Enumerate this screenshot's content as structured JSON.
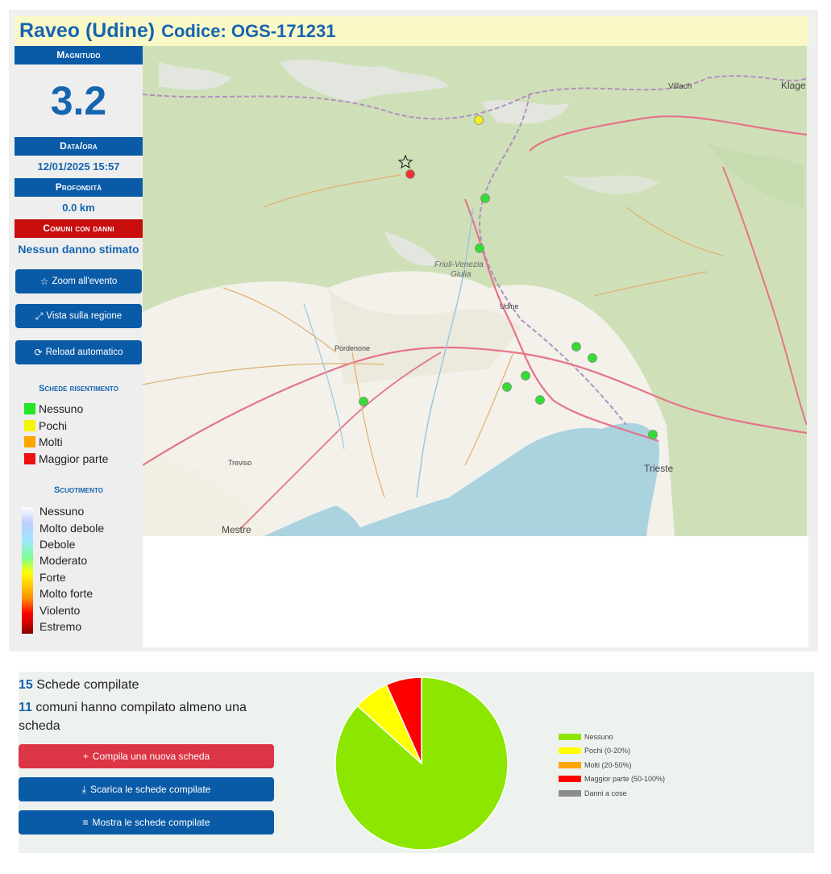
{
  "event": {
    "place": "Raveo (Udine)",
    "code_label": "Codice: OGS-171231"
  },
  "sidebar": {
    "magnitude_label": "Magnitudo",
    "magnitude_value": "3.2",
    "datetime_label": "Data/ora",
    "datetime_value": "12/01/2025 15:57",
    "depth_label": "Profondità",
    "depth_value": "0.0 km",
    "damage_label": "Comuni con danni",
    "damage_value": "Nessun danno stimato",
    "buttons": {
      "zoom": "Zoom all'evento",
      "region": "Vista sulla regione",
      "reload": "Reload automatico"
    },
    "felt_title": "Schede risentimento",
    "felt_items": [
      {
        "label": "Nessuno",
        "color": "#22e622"
      },
      {
        "label": "Pochi",
        "color": "#f5f500"
      },
      {
        "label": "Molti",
        "color": "#ffa500"
      },
      {
        "label": "Maggior parte",
        "color": "#ee1111"
      }
    ],
    "shake_title": "Scuotimento",
    "shake_items": [
      "Nessuno",
      "Molto debole",
      "Debole",
      "Moderato",
      "Forte",
      "Molto forte",
      "Violento",
      "Estremo"
    ]
  },
  "map": {
    "labels": {
      "villach": "Villach",
      "klage": "Klage",
      "region": "Friuli-Venezia",
      "region2": "Giulia",
      "udine": "Udine",
      "pordenone": "Pordenone",
      "treviso": "Treviso",
      "trieste": "Trieste",
      "mestre": "Mestre"
    },
    "colors": {
      "green": "#33dd33",
      "yellow": "#f0f022",
      "red": "#ee3333"
    }
  },
  "stats": {
    "forms_count": "15",
    "forms_text": "Schede compilate",
    "towns_count": "11",
    "towns_text_1": "comuni hanno compilato almeno una",
    "towns_text_2": "scheda"
  },
  "actions": {
    "new_form": "Compila una nuova scheda",
    "download": "Scarica le schede compilate",
    "show": "Mostra le schede compilate"
  },
  "chart_data": {
    "type": "pie",
    "values": [
      13,
      1,
      0,
      1,
      0
    ],
    "labels": [
      "Nessuno",
      "Pochi (0-20%)",
      "Molti (20-50%)",
      "Maggior parte (50-100%)",
      "Danni a cose"
    ],
    "colors": [
      "#8ce600",
      "#ffff00",
      "#ffa500",
      "#ff0000",
      "#8c8c8c"
    ],
    "legend_position": "right"
  }
}
